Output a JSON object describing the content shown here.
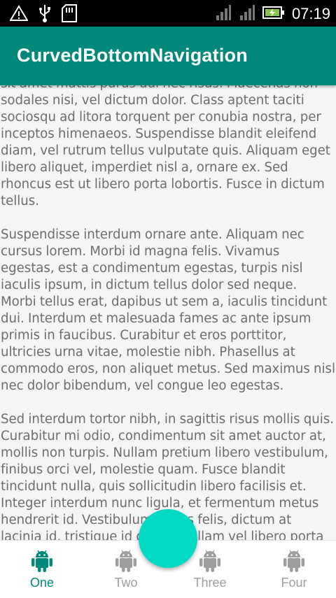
{
  "status_bar": {
    "time": "07:19",
    "left_icons": [
      "warning-icon",
      "usb-icon",
      "sd-card-icon"
    ],
    "right_icons": [
      "signal-icon",
      "signal-icon",
      "battery-charging-icon"
    ]
  },
  "app_bar": {
    "title": "CurvedBottomNavigation"
  },
  "content": {
    "paragraphs": [
      "sit amet mattis purus dui nec risus. Maecenas non sodales nisi, vel dictum dolor. Class aptent taciti sociosqu ad litora torquent per conubia nostra, per inceptos himenaeos. Suspendisse blandit eleifend diam, vel rutrum tellus vulputate quis. Aliquam eget libero aliquet, imperdiet nisl a, ornare ex. Sed rhoncus est ut libero porta lobortis. Fusce in dictum tellus.",
      " Suspendisse interdum ornare ante. Aliquam nec cursus lorem. Morbi id magna felis. Vivamus egestas, est a condimentum egestas, turpis nisl iaculis ipsum, in dictum tellus dolor sed neque. Morbi tellus erat, dapibus ut sem a, iaculis tincidunt dui. Interdum et malesuada fames ac ante ipsum primis in faucibus. Curabitur et eros porttitor, ultricies urna vitae, molestie nibh. Phasellus at commodo eros, non aliquet metus. Sed maximus nisl nec dolor bibendum, vel congue leo egestas.",
      " Sed interdum tortor nibh, in sagittis risus mollis quis. Curabitur mi odio, condimentum sit amet auctor at, mollis non turpis. Nullam pretium libero vestibulum, finibus orci vel, molestie quam. Fusce blandit tincidunt nulla, quis sollicitudin libero facilisis et. Integer interdum nunc ligula, et fermentum metus hendrerit id. Vestibulum lectus felis, dictum at lacinia id, tristique id quam. Nullam vel libero porta sem"
    ]
  },
  "bottom_nav": {
    "tabs": [
      {
        "label": "One",
        "icon": "android-icon",
        "selected": true
      },
      {
        "label": "Two",
        "icon": "android-icon",
        "selected": false
      },
      {
        "label": "Three",
        "icon": "android-icon",
        "selected": false
      },
      {
        "label": "Four",
        "icon": "android-icon",
        "selected": false
      }
    ],
    "active_color": "#00897b",
    "inactive_color": "#9e9e9e",
    "fab_color": "#00d9c4"
  },
  "colors": {
    "app_bar": "#00897b",
    "status_bar": "#000000",
    "body_text": "#6d6d6d"
  }
}
